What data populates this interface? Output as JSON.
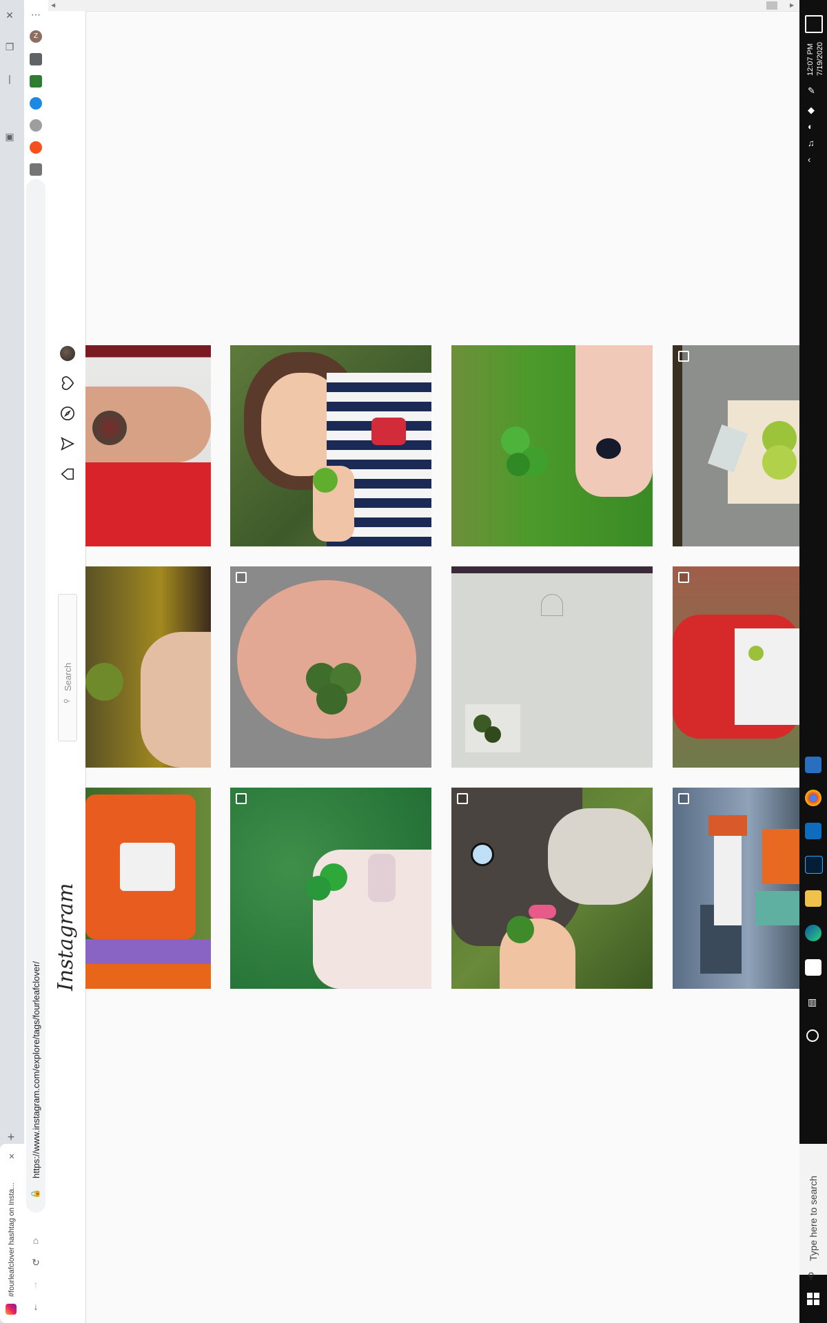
{
  "browser": {
    "url": "https://www.instagram.com/explore/tags/fourleafclover/",
    "tab_title": "#fourleafclover hashtag on Insta...",
    "new_tab_label": "+"
  },
  "instagram": {
    "logo": "Instagram",
    "search_placeholder": "Search",
    "nav_icons": [
      "avatar",
      "heart-icon",
      "compass-icon",
      "direct-icon",
      "home-icon"
    ]
  },
  "grid": {
    "rows": [
      [
        {
          "subject": "arm tattoo",
          "multiple": false
        },
        {
          "subject": "girl holding clover",
          "multiple": false
        },
        {
          "subject": "hand holding clover on grass",
          "multiple": false
        },
        {
          "subject": "clover artwork on paper",
          "multiple": true
        }
      ],
      [
        {
          "subject": "hand holding clover",
          "multiple": false
        },
        {
          "subject": "clover shoulder tattoo",
          "multiple": true
        },
        {
          "subject": "pressed clover with sketch",
          "multiple": false
        },
        {
          "subject": "person in red jacket",
          "multiple": true
        }
      ],
      [
        {
          "subject": "orange chainsaw",
          "multiple": false
        },
        {
          "subject": "clover on fingers",
          "multiple": true
        },
        {
          "subject": "husky with clover",
          "multiple": true
        },
        {
          "subject": "lighthouse by the water",
          "multiple": true
        }
      ]
    ]
  },
  "taskbar": {
    "time": "12:07 PM",
    "date": "7/19/2020",
    "search_placeholder": "Type here to search"
  },
  "colors": {
    "instagram_bg": "#fafafa",
    "taskbar": "#0f0f0f",
    "chainsaw_orange": "#e85d1f",
    "grass_green": "#3f8f2a"
  }
}
